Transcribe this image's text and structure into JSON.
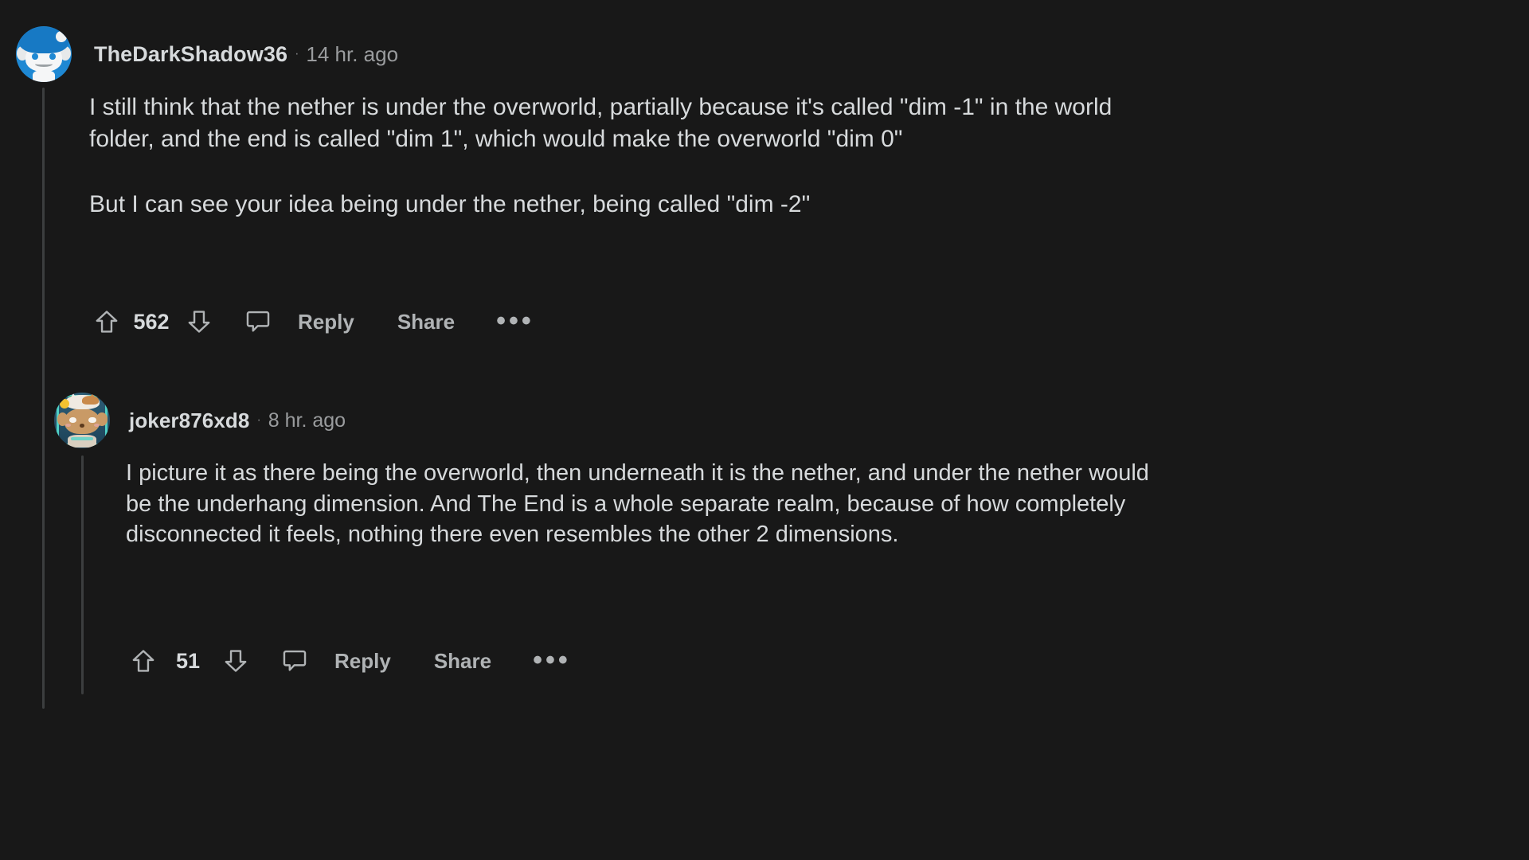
{
  "theme": {
    "background": "#181818",
    "text_primary": "#d7dadc",
    "text_secondary": "#9a9c9e",
    "thread_line": "#3c3e3f"
  },
  "comments": [
    {
      "username": "TheDarkShadow36",
      "separator": "·",
      "timestamp": "14 hr. ago",
      "avatar": "reddit-snoo-blue-beanie",
      "paragraphs": [
        "I still think that the nether is under the overworld, partially because it's called \"dim -1\" in the world folder, and the end is called \"dim 1\", which would make the overworld \"dim 0\"",
        "But I can see your idea being under the nether, being called \"dim -2\""
      ],
      "actions": {
        "upvote_icon": "arrow-up-icon",
        "vote_count": "562",
        "downvote_icon": "arrow-down-icon",
        "comment_icon": "comment-bubble-icon",
        "reply_label": "Reply",
        "share_label": "Share",
        "more_label": "•••"
      }
    },
    {
      "username": "joker876xd8",
      "separator": "·",
      "timestamp": "8 hr. ago",
      "avatar": "reddit-snoo-tan-cat-hat",
      "paragraphs": [
        "I picture it as there being the overworld, then underneath it is the nether, and under the nether would be the underhang dimension. And The End is a whole separate realm, because of how completely disconnected it feels, nothing there even resembles the other 2 dimensions."
      ],
      "actions": {
        "upvote_icon": "arrow-up-icon",
        "vote_count": "51",
        "downvote_icon": "arrow-down-icon",
        "comment_icon": "comment-bubble-icon",
        "reply_label": "Reply",
        "share_label": "Share",
        "more_label": "•••"
      }
    }
  ]
}
